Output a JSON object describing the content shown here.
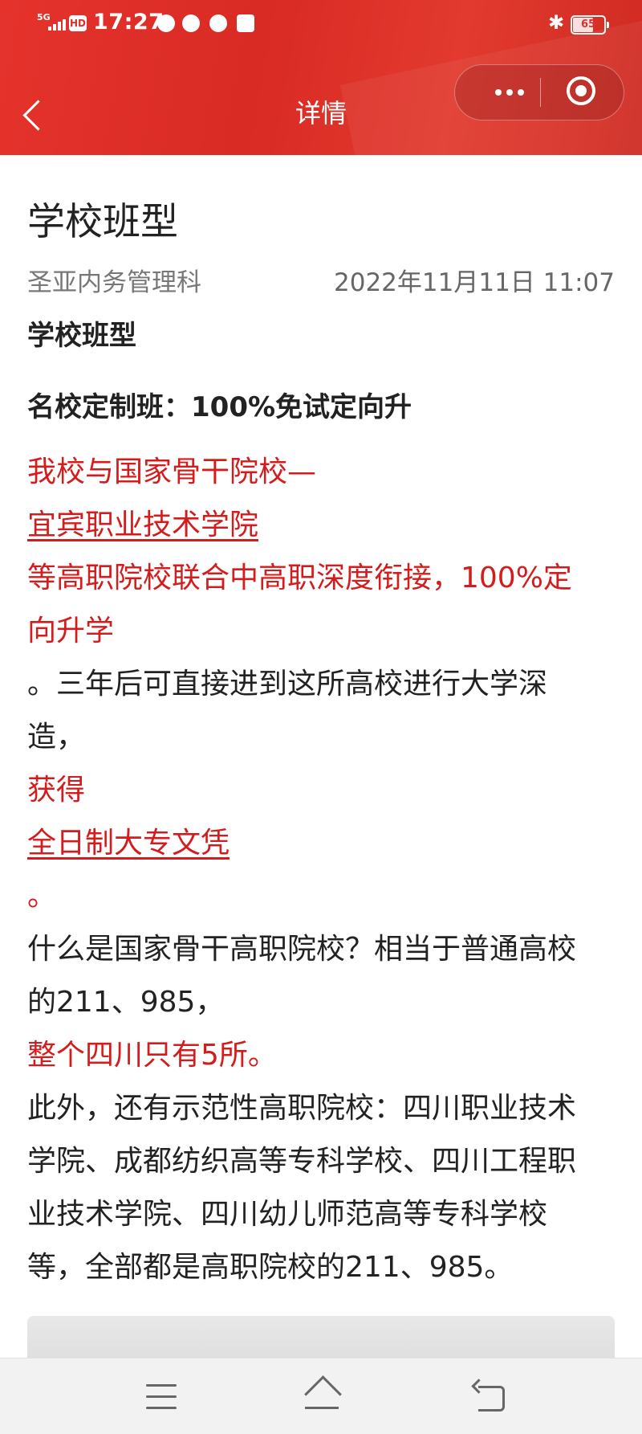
{
  "status_bar": {
    "network": "5G",
    "hd": "HD",
    "time": "17:27",
    "battery": "65",
    "icons": [
      "signal-icon",
      "hd-icon",
      "compass-icon",
      "wechat-icon",
      "search-app-icon",
      "app-icon",
      "bluetooth-icon",
      "battery-icon"
    ]
  },
  "header": {
    "title": "详情",
    "accent_color": "#d92a24"
  },
  "article": {
    "title": "学校班型",
    "author": "圣亚内务管理科",
    "date": "2022年11月11日 11:07",
    "section_heading": "学校班型",
    "subheading": "名校定制班：100%免试定向升",
    "lines": [
      "我校与国家骨干院校—",
      "宜宾职业技术学院",
      "等高职院校联合中高职深度衔接，100%定",
      "向升学",
      "。三年后可直接进到这所高校进行大学深",
      "造，",
      "获得",
      "全日制大专文凭",
      "。",
      "什么是国家骨干高职院校？相当于普通高校",
      "的211、985，",
      "整个四川只有5所。",
      "此外，还有示范性高职院校：四川职业技术",
      "学院、成都纺织高等专科学校、四川工程职",
      "业技术学院、四川幼儿师范高等专科学校",
      "等，全部都是高职院校的211、985。"
    ],
    "highlight_color": "#d51c1c"
  }
}
